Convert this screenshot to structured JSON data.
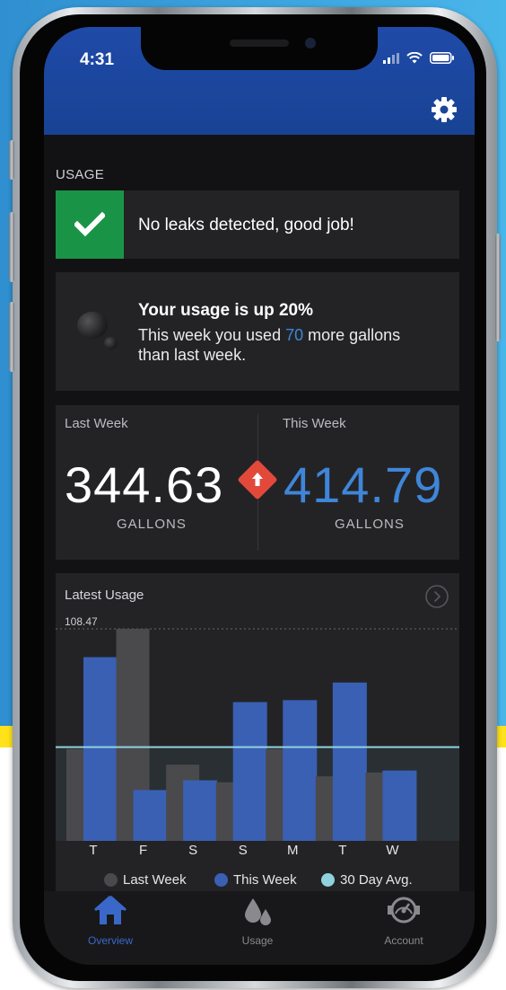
{
  "status_bar": {
    "time": "4:31"
  },
  "section": {
    "label": "USAGE"
  },
  "leak_card": {
    "message": "No leaks detected, good job!"
  },
  "usage_card": {
    "title": "Your usage is up 20%",
    "line1_prefix": "This week you used ",
    "line1_number": "70",
    "line1_suffix": " more gallons",
    "line2": "than last week."
  },
  "comparison": {
    "last_week": {
      "label": "Last Week",
      "value": "344.63",
      "unit": "GALLONS"
    },
    "this_week": {
      "label": "This Week",
      "value": "414.79",
      "unit": "GALLONS"
    }
  },
  "chart_card": {
    "title": "Latest Usage",
    "max_label": "108.47"
  },
  "chart_data": {
    "type": "bar",
    "title": "Latest Usage",
    "categories": [
      "T",
      "F",
      "S",
      "S",
      "M",
      "T",
      "W"
    ],
    "series": [
      {
        "name": "Last Week",
        "color": "#4a4a4c",
        "values": [
          47,
          108.47,
          39,
          30,
          47,
          33,
          35
        ]
      },
      {
        "name": "This Week",
        "color": "#3a60b4",
        "values": [
          94,
          26,
          31,
          71,
          72,
          81,
          36
        ]
      }
    ],
    "average": {
      "name": "30 Day Avg.",
      "color": "#8fd2de",
      "value": 48
    },
    "ylim": [
      0,
      108.47
    ]
  },
  "legend": [
    {
      "label": "Last Week",
      "color": "#4a4a4c"
    },
    {
      "label": "This Week",
      "color": "#3a60b4"
    },
    {
      "label": "30 Day Avg.",
      "color": "#8fd2de"
    }
  ],
  "tabs": [
    {
      "label": "Overview",
      "icon": "home-icon",
      "active": true
    },
    {
      "label": "Usage",
      "icon": "water-drops-icon",
      "active": false
    },
    {
      "label": "Account",
      "icon": "meter-icon",
      "active": false
    }
  ],
  "colors": {
    "header_blue": "#1f4aa8",
    "accent_blue": "#3f86d8",
    "success_green": "#199447",
    "alert_red": "#e2493b"
  }
}
